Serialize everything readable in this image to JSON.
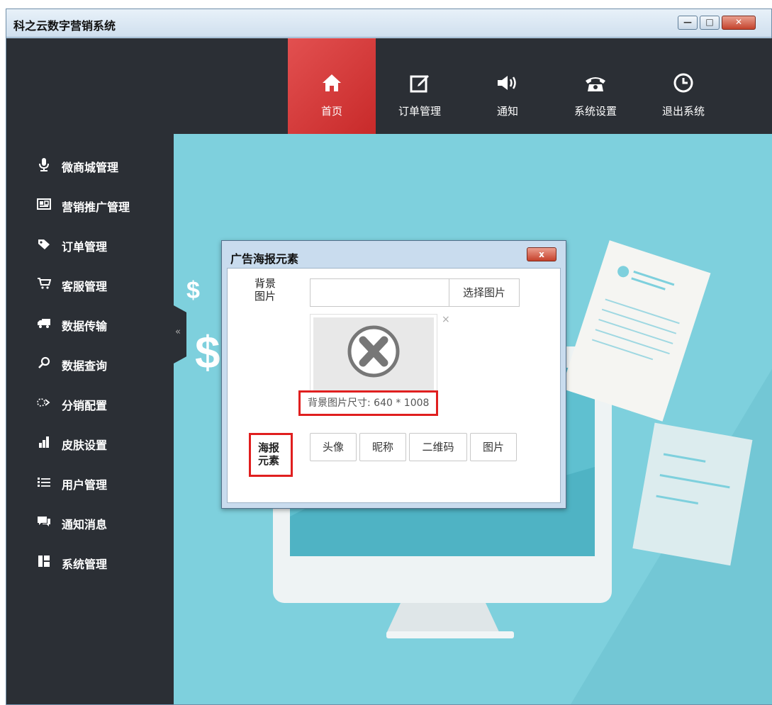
{
  "window": {
    "title": "科之云数字营销系统"
  },
  "topnav": {
    "items": [
      {
        "label": "首页",
        "icon": "home-icon",
        "active": true
      },
      {
        "label": "订单管理",
        "icon": "edit-icon",
        "active": false
      },
      {
        "label": "通知",
        "icon": "speaker-icon",
        "active": false
      },
      {
        "label": "系统设置",
        "icon": "telephone-icon",
        "active": false
      },
      {
        "label": "退出系统",
        "icon": "clock-icon",
        "active": false
      }
    ]
  },
  "sidebar": {
    "items": [
      {
        "label": "微商城管理",
        "icon": "microphone-icon"
      },
      {
        "label": "营销推广管理",
        "icon": "qr-card-icon"
      },
      {
        "label": "订单管理",
        "icon": "tag-icon"
      },
      {
        "label": "客服管理",
        "icon": "cart-icon"
      },
      {
        "label": "数据传输",
        "icon": "truck-icon"
      },
      {
        "label": "数据查询",
        "icon": "search-icon"
      },
      {
        "label": "分销配置",
        "icon": "share-icon"
      },
      {
        "label": "皮肤设置",
        "icon": "chart-icon"
      },
      {
        "label": "用户管理",
        "icon": "list-icon"
      },
      {
        "label": "通知消息",
        "icon": "chat-icon"
      },
      {
        "label": "系统管理",
        "icon": "layout-icon"
      }
    ],
    "collapse_glyph": "«"
  },
  "dialog": {
    "title": "广告海报元素",
    "close_glyph": "x",
    "bg_image_label_line1": "背景",
    "bg_image_label_line2": "图片",
    "bg_input_value": "",
    "choose_button": "选择图片",
    "remove_glyph": "×",
    "size_note": "背景图片尺寸: 640 * 1008",
    "elements_label_line1": "海报",
    "elements_label_line2": "元素",
    "element_buttons": [
      "头像",
      "昵称",
      "二维码",
      "图片"
    ]
  },
  "colors": {
    "dark_bg": "#2b2f35",
    "active_nav": "#d33a3a",
    "main_bg": "#7ed0dd",
    "highlight_red": "#e01f1f"
  }
}
